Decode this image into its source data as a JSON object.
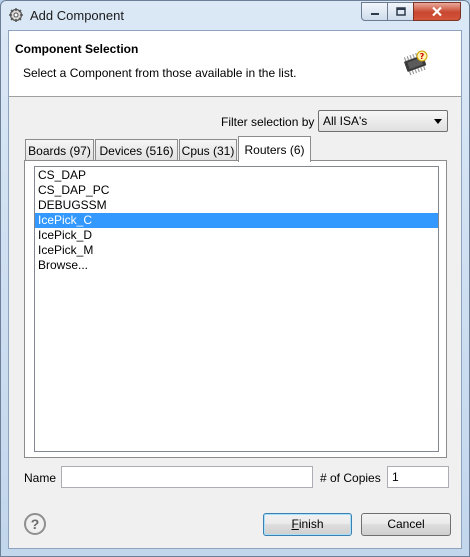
{
  "window": {
    "title": "Add Component",
    "buttons": {
      "minimize": "minimize-icon",
      "maximize": "maximize-icon",
      "close": "close-icon"
    }
  },
  "header": {
    "title": "Component Selection",
    "description": "Select a Component from those available in the list."
  },
  "filter": {
    "label": "Filter selection by",
    "selected": "All ISA's"
  },
  "tabs": [
    {
      "label": "Boards (97)",
      "active": false
    },
    {
      "label": "Devices (516)",
      "active": false
    },
    {
      "label": "Cpus (31)",
      "active": false
    },
    {
      "label": "Routers (6)",
      "active": true
    }
  ],
  "list": {
    "items": [
      "CS_DAP",
      "CS_DAP_PC",
      "DEBUGSSM",
      "IcePick_C",
      "IcePick_D",
      "IcePick_M",
      "Browse..."
    ],
    "selected": "IcePick_C"
  },
  "form": {
    "name_label": "Name",
    "name_value": "",
    "copies_label": "# of Copies",
    "copies_value": "1"
  },
  "footer": {
    "help": "?",
    "finish_first": "F",
    "finish_rest": "inish",
    "cancel": "Cancel"
  },
  "colors": {
    "selection": "#3399ff",
    "close_button": "#c8472e"
  }
}
